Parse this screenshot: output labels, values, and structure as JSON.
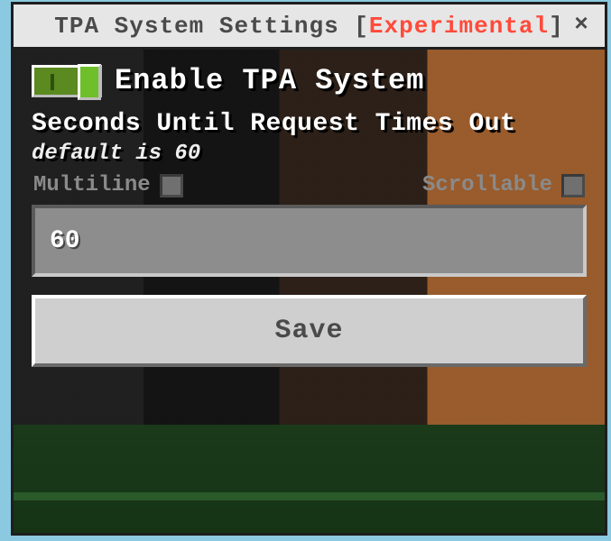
{
  "titlebar": {
    "prefix": "TPA System Settings ",
    "bracket_open": "[",
    "experimental": "Experimental",
    "bracket_close": "]"
  },
  "toggle": {
    "label": "Enable TPA System",
    "on": true
  },
  "timeout": {
    "title": "Seconds Until Request Times Out",
    "subtitle": "default is 60",
    "multiline_label": "Multiline",
    "multiline_checked": false,
    "scrollable_label": "Scrollable",
    "scrollable_checked": false,
    "value": "60"
  },
  "save_label": "Save"
}
